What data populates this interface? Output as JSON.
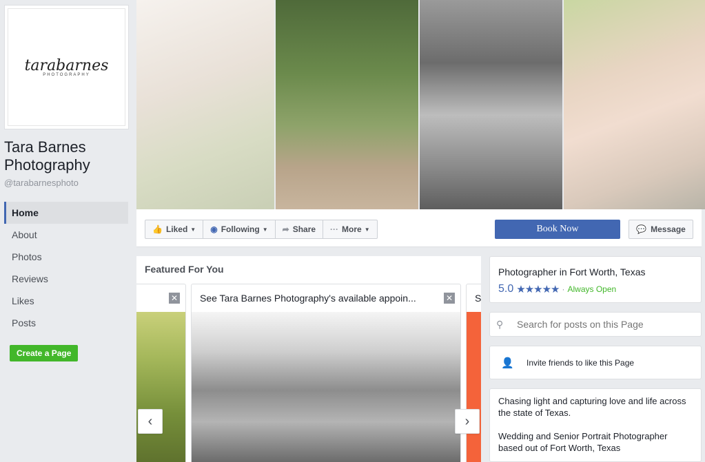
{
  "profile": {
    "logo_main": "tarabarnes",
    "logo_sub": "PHOTOGRAPHY",
    "name": "Tara Barnes Photography",
    "handle": "@tarabarnesphoto"
  },
  "nav": {
    "items": [
      {
        "label": "Home"
      },
      {
        "label": "About"
      },
      {
        "label": "Photos"
      },
      {
        "label": "Reviews"
      },
      {
        "label": "Likes"
      },
      {
        "label": "Posts"
      }
    ],
    "create_page": "Create a Page"
  },
  "actions": {
    "liked": "Liked",
    "following": "Following",
    "share": "Share",
    "more": "More",
    "book_now": "Book Now",
    "message": "Message"
  },
  "featured": {
    "title": "Featured For You",
    "card_main_title": "See Tara Barnes Photography's available appoin...",
    "card_right_title": "S"
  },
  "info": {
    "category": "Photographer in Fort Worth, Texas",
    "rating": "5.0",
    "stars": "★★★★★",
    "open_status": "Always Open",
    "search_placeholder": "Search for posts on this Page",
    "invite": "Invite friends to like this Page",
    "about_1": "Chasing light and capturing love and life across the state of Texas.",
    "about_2": "Wedding and Senior Portrait Photographer based out of Fort Worth, Texas"
  },
  "colors": {
    "brand_blue": "#4267b2",
    "green": "#42b72a",
    "background": "#e9ebee"
  }
}
